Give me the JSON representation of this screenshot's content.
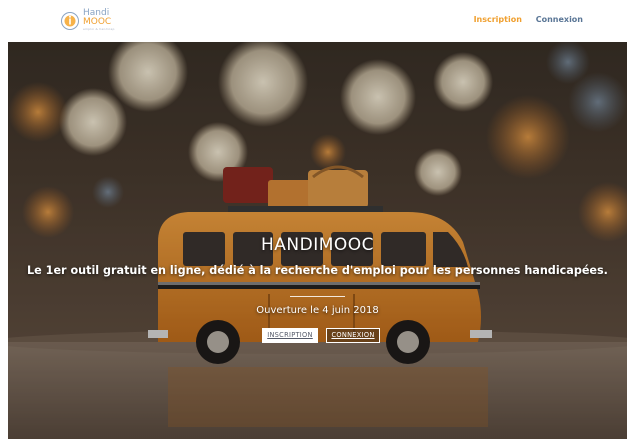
{
  "header": {
    "logo": {
      "line1": "Handi",
      "line2": "MOOC",
      "tagline": "emploi & handicap"
    },
    "nav": {
      "inscription": "Inscription",
      "connexion": "Connexion"
    },
    "colors": {
      "accent": "#f0a030",
      "nav_secondary": "#5a7696"
    }
  },
  "hero": {
    "title": "HANDIMOOC",
    "subtitle": "Le 1er outil gratuit en ligne, dédié à la recherche d'emploi pour les personnes handicapées.",
    "date": "Ouverture le 4 juin 2018",
    "buttons": {
      "inscription": "INSCRIPTION",
      "connexion": "CONNEXION"
    },
    "image": "toy-van-bokeh-photo"
  }
}
